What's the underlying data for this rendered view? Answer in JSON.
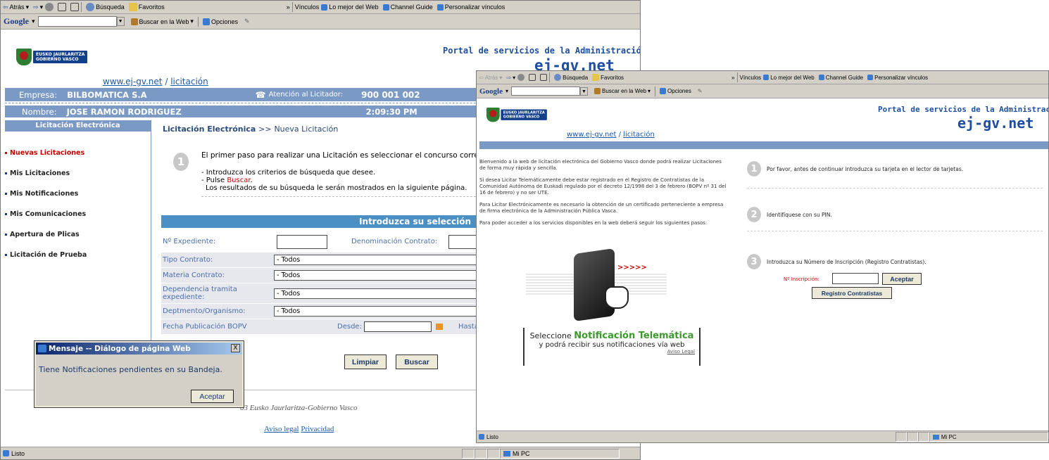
{
  "toolbar": {
    "back": "Atrás",
    "search": "Búsqueda",
    "favorites": "Favoritos",
    "links_label": "Vínculos",
    "link1": "Lo mejor del Web",
    "link2": "Channel Guide",
    "link3": "Personalizar vínculos",
    "google": "Google",
    "search_web": "Buscar en la Web",
    "options": "Opciones"
  },
  "header": {
    "portal": "Portal de servicios de la Administración Vasca",
    "ejgv": "ej-gv.net",
    "emblem1": "EUSKO JAURLARITZA",
    "emblem2": "GOBIERNO VASCO",
    "bc_site": "www.ej-gv.net",
    "bc_sep": "/",
    "bc_page": "licitación"
  },
  "info": {
    "empresa_label": "Empresa:",
    "empresa": "BILBOMATICA S.A",
    "atencion_label": "Atención al Licitador:",
    "phone": "900 001 002",
    "nombre_label": "Nombre:",
    "nombre": "JOSE RAMON RODRIGUEZ",
    "time": "2:09:30 PM"
  },
  "sidebar": {
    "title": "Licitación Electrónica",
    "items": [
      {
        "label": "Nuevas Licitaciones"
      },
      {
        "label": "Mis Licitaciones"
      },
      {
        "label": "Mis Notificaciones"
      },
      {
        "label": "Mis Comunicaciones"
      },
      {
        "label": "Apertura de Plicas"
      },
      {
        "label": "Licitación de Prueba"
      }
    ]
  },
  "main": {
    "bc1": "Licitación Electrónica",
    "bc_sep": ">>",
    "bc2": "Nueva Licitación",
    "step_num": "1",
    "intro": "El primer paso para realizar una Licitación es seleccionar el concurso correspond",
    "bullet1": "- Introduzca los criterios de búsqueda que desee.",
    "bullet2_pre": "- Pulse",
    "bullet2_link": "Buscar",
    "bullet2_post": ".",
    "bullet3": "Los resultados de su búsqueda le serán mostrados en la siguiente página.",
    "form_title": "Introduzca su selección",
    "expediente_label": "Nº Expediente:",
    "denominacion_label": "Denominación Contrato:",
    "tipo_label": "Tipo Contrato:",
    "tipo_value": "- Todos",
    "materia_label": "Materia Contrato:",
    "materia_value": "- Todos",
    "dependencia_label": "Dependencia tramita expediente:",
    "dependencia_value": "- Todos",
    "deptmento_label": "Deptmento/Organismo:",
    "deptmento_value": "- Todos",
    "fecha_label": "Fecha Publicación BOPV",
    "desde_label": "Desde:",
    "hasta_label": "Hasta",
    "limpiar": "Limpiar",
    "buscar": "Buscar",
    "copyright": "03 Eusko Jaurlaritza-Gobierno Vasco",
    "aviso": "Aviso legal",
    "privacidad": "Privacidad"
  },
  "dialog": {
    "title": "Mensaje -- Diálogo de página Web",
    "message": "Tiene Notificaciones pendientes en su Bandeja.",
    "accept": "Aceptar",
    "close": "X"
  },
  "status": {
    "listo": "Listo",
    "mipc": "Mi PC"
  },
  "win2": {
    "intro1": "Bienvenido a la web de licitación electrónica del Gobierno Vasco donde podrá realizar Licitaciones de forma muy rápida y sencilla.",
    "intro2": "Si desea Licitar Telemáticamente debe estar registrado en el Registro de Contratistas de la Comunidad Autónoma de Euskadi regulado por el decreto 12/1998 del 3 de febrero (BOPV nº 31 del 16 de febrero) y no ser UTE.",
    "intro3": "Para Licitar Electrónicamente es necesario la obtención de un certificado perteneciente a empresa de firma electrónica de la Administración Pública Vasca.",
    "intro4": "Para poder acceder a los servicios disponibles en la web deberá seguir los siguientes pasos:",
    "arrows": ">>>>>",
    "step1_num": "1",
    "step1": "Por favor, antes de continuar introduzca su tarjeta en el lector de tarjetas.",
    "step2_num": "2",
    "step2": "Identifíquese con su PIN.",
    "step3_num": "3",
    "step3": "Introduzca su Número de Inscripción (Registro Contratistas).",
    "inscripcion_label": "Nº Inscripción:",
    "aceptar": "Aceptar",
    "registro": "Registro Contratistas",
    "notif1": "Seleccione",
    "notif2": "Notificación Telemática",
    "notif3": "y podrá recibir sus notificaciones vía web",
    "aviso": "Aviso Legal"
  },
  "colors": {
    "header_blue": "#7a99c4",
    "accent_red": "#cc0000",
    "link_blue": "#1a5aa8"
  }
}
